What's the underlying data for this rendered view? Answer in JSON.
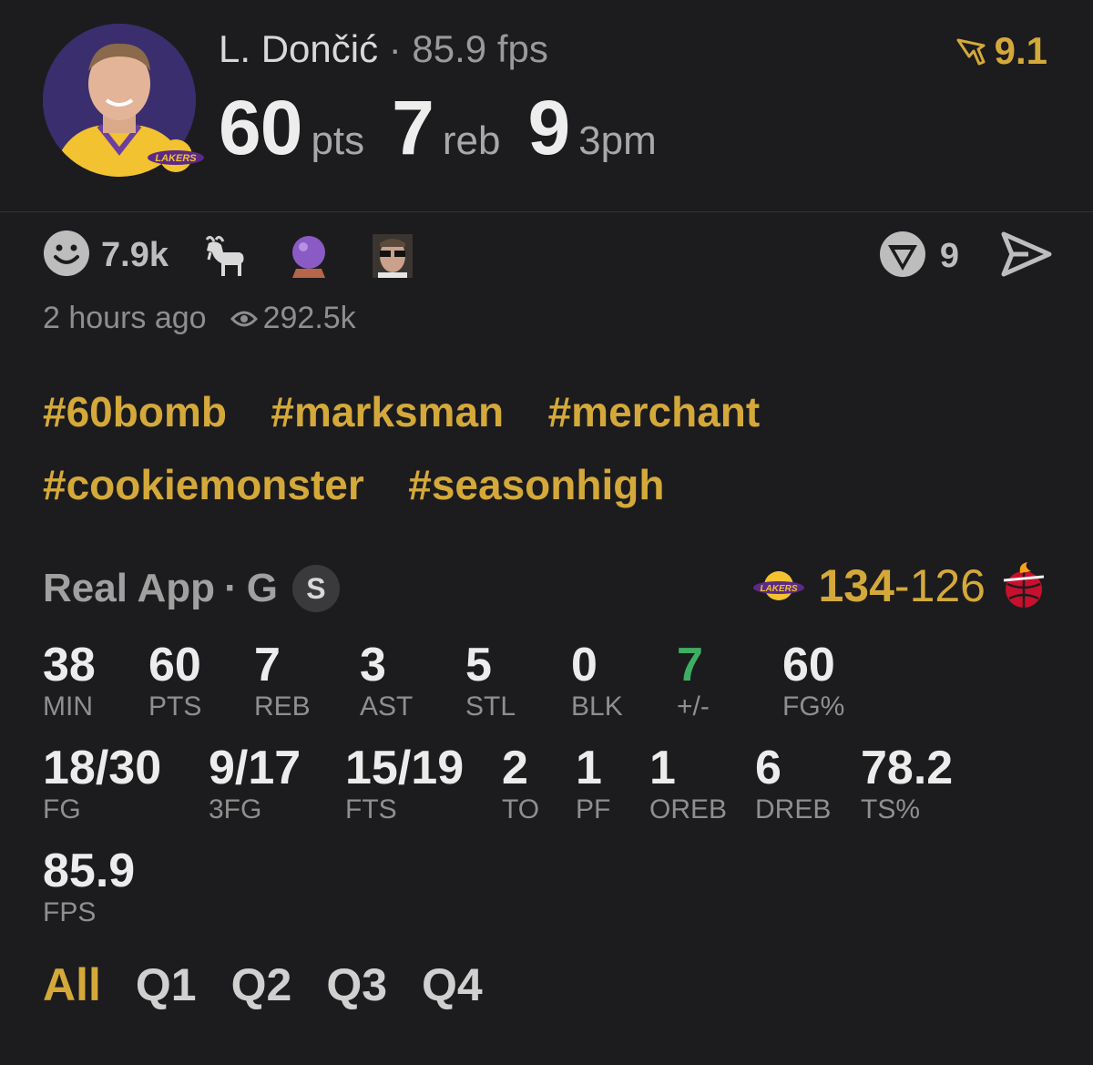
{
  "player": {
    "name": "L. Dončić",
    "sep": "·",
    "fps_text": "85.9 fps",
    "team_logo_text": "LAKERS"
  },
  "headline": [
    {
      "value": "60",
      "unit": "pts"
    },
    {
      "value": "7",
      "unit": "reb"
    },
    {
      "value": "9",
      "unit": "3pm"
    }
  ],
  "rating": "9.1",
  "reactions": {
    "count": "7.9k",
    "emojis": [
      "smiley-icon",
      "goat-icon",
      "crystal-ball-icon",
      "sunglasses-face-icon"
    ]
  },
  "actions": {
    "fire_count": "9"
  },
  "meta": {
    "time": "2 hours ago",
    "views": "292.5k"
  },
  "hashtags": [
    "#60bomb",
    "#marksman",
    "#merchant",
    "#cookiemonster",
    "#seasonhigh"
  ],
  "game": {
    "source": "Real App",
    "sep": "·",
    "position": "G",
    "badge": "S",
    "home_logo_text": "LAKERS",
    "score_home": "134",
    "score_dash": "-",
    "score_away": "126"
  },
  "stats_row1": [
    {
      "value": "38",
      "label": "MIN"
    },
    {
      "value": "60",
      "label": "PTS"
    },
    {
      "value": "7",
      "label": "REB"
    },
    {
      "value": "3",
      "label": "AST"
    },
    {
      "value": "5",
      "label": "STL"
    },
    {
      "value": "0",
      "label": "BLK"
    },
    {
      "value": "7",
      "label": "+/-"
    },
    {
      "value": "60",
      "label": "FG%"
    }
  ],
  "stats_row2": [
    {
      "value": "18/30",
      "label": "FG"
    },
    {
      "value": "9/17",
      "label": "3FG"
    },
    {
      "value": "15/19",
      "label": "FTS"
    },
    {
      "value": "2",
      "label": "TO"
    },
    {
      "value": "1",
      "label": "PF"
    },
    {
      "value": "1",
      "label": "OREB"
    },
    {
      "value": "6",
      "label": "DREB"
    },
    {
      "value": "78.2",
      "label": "TS%"
    }
  ],
  "stats_row3": [
    {
      "value": "85.9",
      "label": "FPS"
    }
  ],
  "tabs": [
    "All",
    "Q1",
    "Q2",
    "Q3",
    "Q4"
  ],
  "colors": {
    "accent": "#d4a93a",
    "positive": "#3fae63",
    "background": "#1c1c1e"
  }
}
